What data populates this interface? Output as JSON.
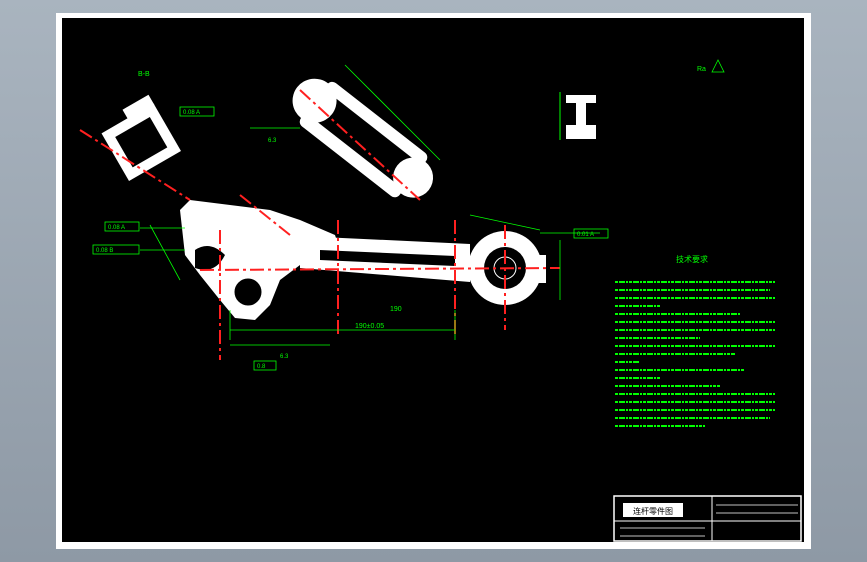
{
  "drawing": {
    "section_label": "B-B",
    "roughness_symbol_label": "Ra",
    "tech_requirements_title": "技术要求"
  },
  "dimensions": {
    "center_distance": "190±0.05",
    "bar_length": "190",
    "left_flag_1": "0.08 A",
    "left_flag_2": "0.08 B",
    "right_flag": "0.01 A",
    "bottom_flag": "0.8",
    "section_flag": "0.08 A",
    "roughness_top": "6.3",
    "roughness_bottom": "6.3"
  },
  "title_block": {
    "drawing_name": "连杆零件图"
  },
  "colors": {
    "background": "#000000",
    "outline": "#ffffff",
    "dimension": "#00ff00",
    "centerline": "#ff0000",
    "window_bg": "#9aa5b1"
  }
}
